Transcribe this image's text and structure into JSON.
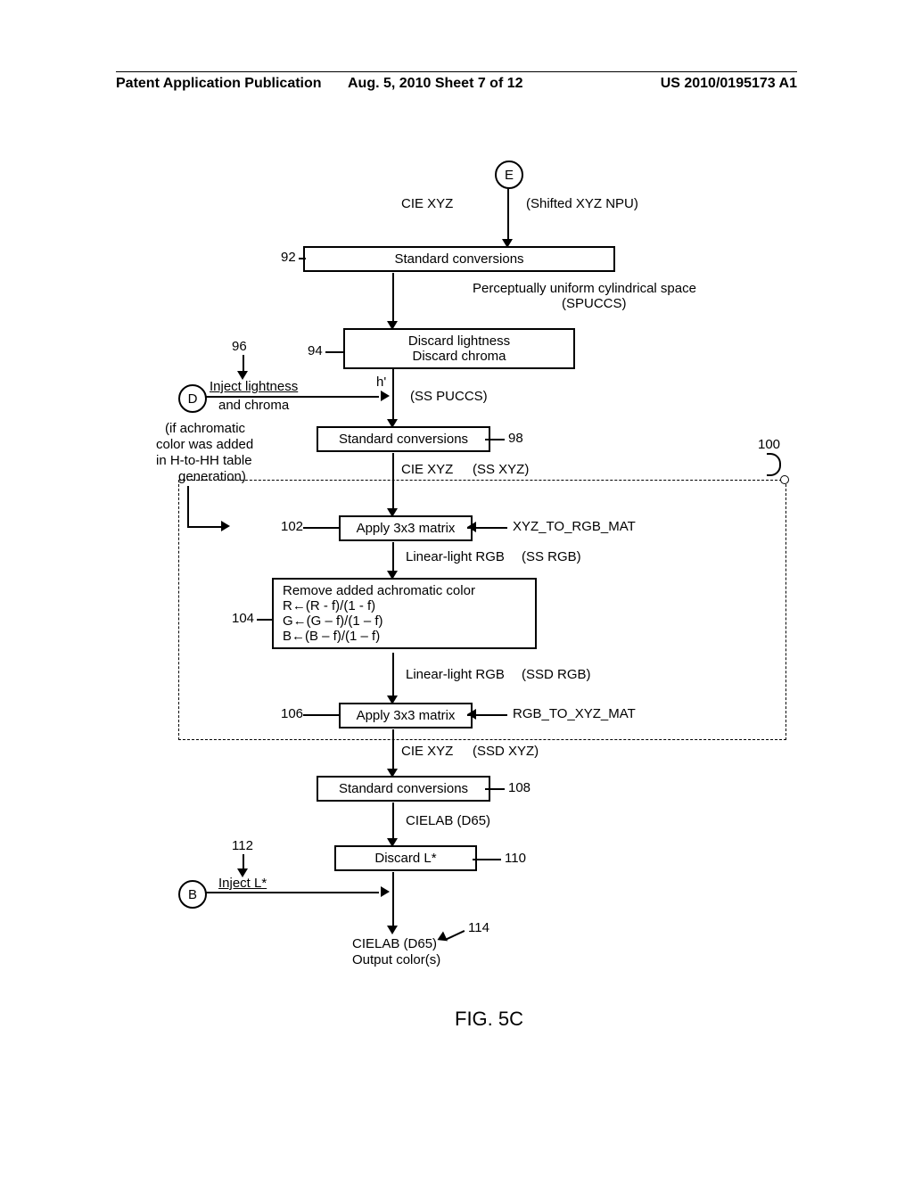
{
  "header": {
    "left": "Patent Application Publication",
    "center": "Aug. 5, 2010  Sheet 7 of 12",
    "right": "US 2010/0195173 A1"
  },
  "connectors": {
    "E": "E",
    "D": "D",
    "B": "B"
  },
  "flow": {
    "in_E": "CIE XYZ",
    "in_E_note": "(Shifted XYZ NPU)",
    "b92": "Standard conversions",
    "r92": "92",
    "after92_a": "Perceptually uniform cylindrical space",
    "after92_b": "(SPUCCS)",
    "b94_a": "Discard lightness",
    "b94_b": "Discard chroma",
    "r94": "94",
    "r96": "96",
    "inject_lc_top": "Inject lightness",
    "inject_lc_bot": "and chroma",
    "h_prime": "h'",
    "ss_puccs": "(SS PUCCS)",
    "achromatic_a": "(if achromatic",
    "achromatic_b": "color was added",
    "achromatic_c": "in H-to-HH table",
    "achromatic_d": "generation)",
    "b98": "Standard conversions",
    "r98": "98",
    "after98": "CIE XYZ",
    "after98_note": "(SS XYZ)",
    "r100": "100",
    "b102": "Apply 3x3 matrix",
    "r102": "102",
    "xyz_to_rgb": "XYZ_TO_RGB_MAT",
    "after102": "Linear-light RGB",
    "after102_note": "(SS RGB)",
    "b104_a": "Remove added achromatic color",
    "b104_b": "R←(R - f)/(1 - f)",
    "b104_c": "G←(G – f)/(1 – f)",
    "b104_d": "B←(B – f)/(1 – f)",
    "r104": "104",
    "after104": "Linear-light RGB",
    "after104_note": "(SSD RGB)",
    "b106": "Apply 3x3 matrix",
    "r106": "106",
    "rgb_to_xyz": "RGB_TO_XYZ_MAT",
    "after106": "CIE XYZ",
    "after106_note": "(SSD XYZ)",
    "b108": "Standard conversions",
    "r108": "108",
    "after108": "CIELAB (D65)",
    "b110": "Discard L*",
    "r110": "110",
    "r112": "112",
    "inject_L": "Inject L*",
    "out_a": "CIELAB (D65)",
    "out_b": "Output color(s)",
    "r114": "114"
  },
  "figure": "FIG. 5C"
}
